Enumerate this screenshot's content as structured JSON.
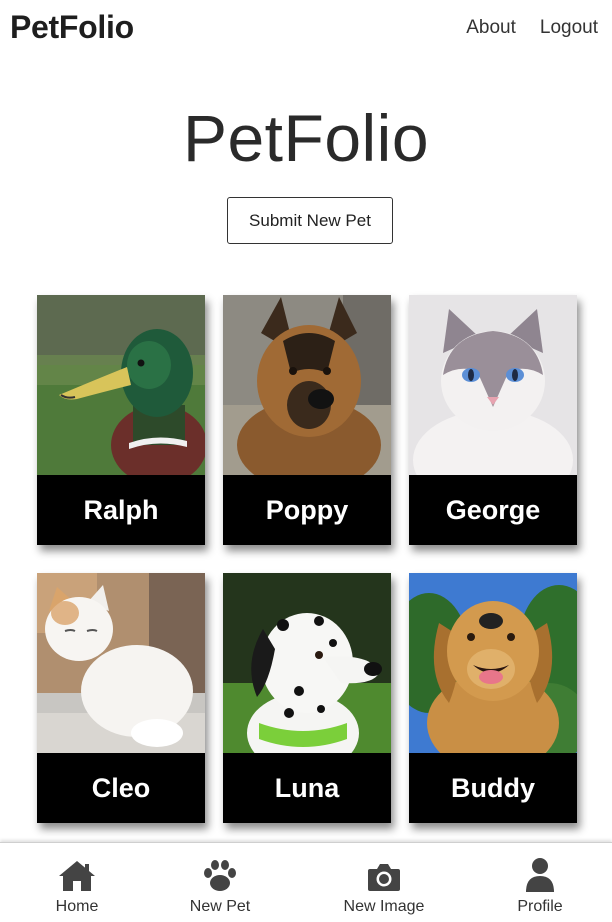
{
  "navbar": {
    "brand": "PetFolio",
    "links": [
      {
        "label": "About"
      },
      {
        "label": "Logout"
      }
    ]
  },
  "hero": {
    "title": "PetFolio",
    "submit_label": "Submit New Pet"
  },
  "pets": [
    {
      "name": "Ralph",
      "photo": "duck-photo"
    },
    {
      "name": "Poppy",
      "photo": "german-shepherd-photo"
    },
    {
      "name": "George",
      "photo": "ragdoll-cat-photo"
    },
    {
      "name": "Cleo",
      "photo": "white-cat-photo"
    },
    {
      "name": "Luna",
      "photo": "dalmatian-photo"
    },
    {
      "name": "Buddy",
      "photo": "golden-retriever-photo"
    }
  ],
  "tabbar": {
    "tabs": [
      {
        "label": "Home",
        "icon": "home-icon"
      },
      {
        "label": "New Pet",
        "icon": "paw-icon"
      },
      {
        "label": "New Image",
        "icon": "camera-icon"
      },
      {
        "label": "Profile",
        "icon": "user-icon"
      }
    ]
  },
  "colors": {
    "card_background": "#000000",
    "card_text": "#ffffff",
    "icon_color": "#444444"
  }
}
